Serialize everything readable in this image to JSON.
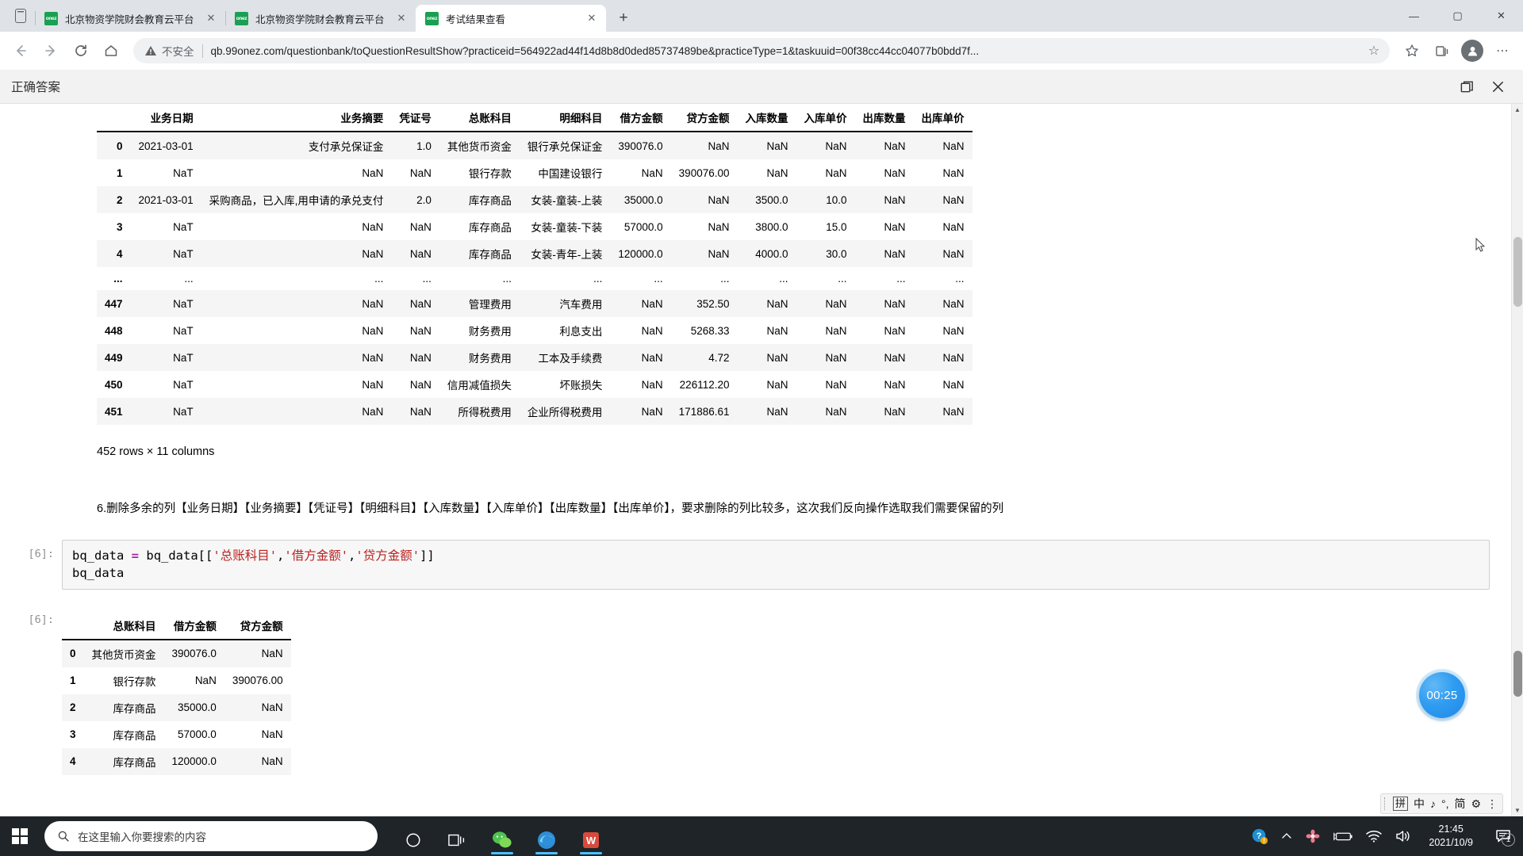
{
  "browser": {
    "tabs": [
      {
        "title": "北京物资学院财会教育云平台",
        "favicon": "onez",
        "active": false
      },
      {
        "title": "北京物资学院财会教育云平台",
        "favicon": "onez",
        "active": false
      },
      {
        "title": "考试结果查看",
        "favicon": "onez",
        "active": true
      }
    ],
    "new_tab_label": "+",
    "window_controls": {
      "minimize": "—",
      "maximize": "▢",
      "close": "✕"
    },
    "toolbar": {
      "back": "←",
      "forward": "→",
      "reload": "⟳",
      "home": "⌂",
      "security_label": "不安全",
      "url": "qb.99onez.com/questionbank/toQuestionResultShow?practiceid=564922ad44f14d8b8d0ded85737489be&practiceType=1&taskuuid=00f38cc44cc04077b0bdd7f...",
      "star": "☆",
      "collections": "collections-icon",
      "favorites": "favorites-icon",
      "profile": "profile-icon",
      "settings_more": "⋯"
    }
  },
  "page_bar": {
    "title": "正确答案",
    "restore_label": "restore-icon",
    "close_label": "✕"
  },
  "notebook": {
    "table1": {
      "columns": [
        "业务日期",
        "业务摘要",
        "凭证号",
        "总账科目",
        "明细科目",
        "借方金额",
        "贷方金额",
        "入库数量",
        "入库单价",
        "出库数量",
        "出库单价"
      ],
      "rows": [
        {
          "index": "0",
          "cells": [
            "2021-03-01",
            "支付承兑保证金",
            "1.0",
            "其他货币资金",
            "银行承兑保证金",
            "390076.0",
            "NaN",
            "NaN",
            "NaN",
            "NaN",
            "NaN"
          ]
        },
        {
          "index": "1",
          "cells": [
            "NaT",
            "NaN",
            "NaN",
            "银行存款",
            "中国建设银行",
            "NaN",
            "390076.00",
            "NaN",
            "NaN",
            "NaN",
            "NaN"
          ]
        },
        {
          "index": "2",
          "cells": [
            "2021-03-01",
            "采购商品，已入库,用申请的承兑支付",
            "2.0",
            "库存商品",
            "女装-童装-上装",
            "35000.0",
            "NaN",
            "3500.0",
            "10.0",
            "NaN",
            "NaN"
          ]
        },
        {
          "index": "3",
          "cells": [
            "NaT",
            "NaN",
            "NaN",
            "库存商品",
            "女装-童装-下装",
            "57000.0",
            "NaN",
            "3800.0",
            "15.0",
            "NaN",
            "NaN"
          ]
        },
        {
          "index": "4",
          "cells": [
            "NaT",
            "NaN",
            "NaN",
            "库存商品",
            "女装-青年-上装",
            "120000.0",
            "NaN",
            "4000.0",
            "30.0",
            "NaN",
            "NaN"
          ]
        },
        {
          "index": "...",
          "cells": [
            "...",
            "...",
            "...",
            "...",
            "...",
            "...",
            "...",
            "...",
            "...",
            "...",
            "..."
          ]
        },
        {
          "index": "447",
          "cells": [
            "NaT",
            "NaN",
            "NaN",
            "管理费用",
            "汽车费用",
            "NaN",
            "352.50",
            "NaN",
            "NaN",
            "NaN",
            "NaN"
          ]
        },
        {
          "index": "448",
          "cells": [
            "NaT",
            "NaN",
            "NaN",
            "财务费用",
            "利息支出",
            "NaN",
            "5268.33",
            "NaN",
            "NaN",
            "NaN",
            "NaN"
          ]
        },
        {
          "index": "449",
          "cells": [
            "NaT",
            "NaN",
            "NaN",
            "财务费用",
            "工本及手续费",
            "NaN",
            "4.72",
            "NaN",
            "NaN",
            "NaN",
            "NaN"
          ]
        },
        {
          "index": "450",
          "cells": [
            "NaT",
            "NaN",
            "NaN",
            "信用减值损失",
            "坏账损失",
            "NaN",
            "226112.20",
            "NaN",
            "NaN",
            "NaN",
            "NaN"
          ]
        },
        {
          "index": "451",
          "cells": [
            "NaT",
            "NaN",
            "NaN",
            "所得税费用",
            "企业所得税费用",
            "NaN",
            "171886.61",
            "NaN",
            "NaN",
            "NaN",
            "NaN"
          ]
        }
      ],
      "shape": "452 rows × 11 columns"
    },
    "markdown": "6.删除多余的列【业务日期】【业务摘要】【凭证号】【明细科目】【入库数量】【入库单价】【出库数量】【出库单价】，要求删除的列比较多，这次我们反向操作选取我们需要保留的列",
    "cell": {
      "in_prompt": "[6]:",
      "out_prompt": "[6]:",
      "code_var": "bq_data",
      "code_op": "=",
      "code_target": "bq_data[[",
      "code_s1": "'总账科目'",
      "code_c1": ",",
      "code_s2": "'借方金额'",
      "code_c2": ",",
      "code_s3": "'贷方金额'",
      "code_tail": "]]",
      "code_line2": "bq_data"
    },
    "table2": {
      "columns": [
        "总账科目",
        "借方金额",
        "贷方金额"
      ],
      "rows": [
        {
          "index": "0",
          "cells": [
            "其他货币资金",
            "390076.0",
            "NaN"
          ]
        },
        {
          "index": "1",
          "cells": [
            "银行存款",
            "NaN",
            "390076.00"
          ]
        },
        {
          "index": "2",
          "cells": [
            "库存商品",
            "35000.0",
            "NaN"
          ]
        },
        {
          "index": "3",
          "cells": [
            "库存商品",
            "57000.0",
            "NaN"
          ]
        },
        {
          "index": "4",
          "cells": [
            "库存商品",
            "120000.0",
            "NaN"
          ]
        }
      ]
    }
  },
  "overlay": {
    "timer": "00:25"
  },
  "ime": {
    "mode_key": "拼",
    "lang": "中",
    "music": "♪",
    "punct": "°,",
    "simplified": "简",
    "settings": "⚙",
    "more": "⋮"
  },
  "taskbar": {
    "start_label": "start-button",
    "search_placeholder": "在这里输入你要搜索的内容",
    "apps": [
      {
        "name": "cortana",
        "glyph": "◯",
        "running": false
      },
      {
        "name": "task-view",
        "glyph": "❏",
        "running": false
      },
      {
        "name": "wechat",
        "glyph": "wechat-icon",
        "running": true
      },
      {
        "name": "microsoft-edge",
        "glyph": "edge-icon",
        "running": true
      },
      {
        "name": "wps-office",
        "glyph": "W",
        "running": true
      }
    ],
    "tray": {
      "help": "?",
      "chevron_up": "⌃",
      "flower": "flower-icon",
      "battery": "battery-icon",
      "wifi": "wifi-icon",
      "volume": "volume-icon",
      "time": "21:45",
      "date": "2021/10/9",
      "notification_count": "1"
    }
  },
  "colors": {
    "accent": "#1aa052",
    "timer_blue": "#2f9cf0",
    "taskbar": "#1f2428",
    "code_bg": "#f7f7f7",
    "string_red": "#ba2121",
    "operator_purple": "#a626a4"
  }
}
